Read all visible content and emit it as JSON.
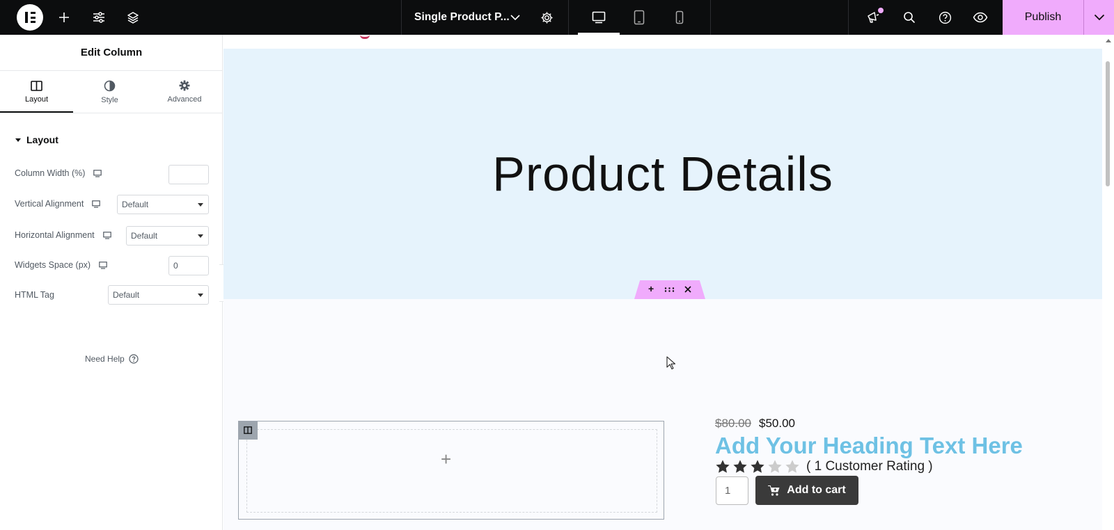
{
  "topbar": {
    "doc_title": "Single Product P...",
    "publish_label": "Publish"
  },
  "panel": {
    "title": "Edit Column",
    "tabs": [
      {
        "label": "Layout",
        "icon": "columns-icon",
        "active": true
      },
      {
        "label": "Style",
        "icon": "half-circle-icon",
        "active": false
      },
      {
        "label": "Advanced",
        "icon": "gear-icon",
        "active": false
      }
    ],
    "section_title": "Layout",
    "controls": {
      "column_width_label": "Column Width (%)",
      "column_width_value": "",
      "vertical_alignment_label": "Vertical Alignment",
      "vertical_alignment_value": "Default",
      "horizontal_alignment_label": "Horizontal Alignment",
      "horizontal_alignment_value": "Default",
      "widgets_space_label": "Widgets Space (px)",
      "widgets_space_value": "0",
      "html_tag_label": "HTML Tag",
      "html_tag_value": "Default"
    },
    "need_help": "Need Help"
  },
  "canvas": {
    "hero_title": "Product Details",
    "product": {
      "price_old": "$80.00",
      "price_new": "$50.00",
      "heading": "Add Your Heading Text Here",
      "rating_value": 3,
      "rating_max": 5,
      "rating_text": "( 1 Customer Rating )",
      "quantity": "1",
      "add_to_cart": "Add to cart"
    }
  },
  "colors": {
    "accent": "#f0abfc",
    "topbar_bg": "#0c0d0e",
    "hero_bg": "#e6f3fc",
    "heading_blue": "#6ec1e4",
    "cart_button": "#3a3a3a"
  }
}
